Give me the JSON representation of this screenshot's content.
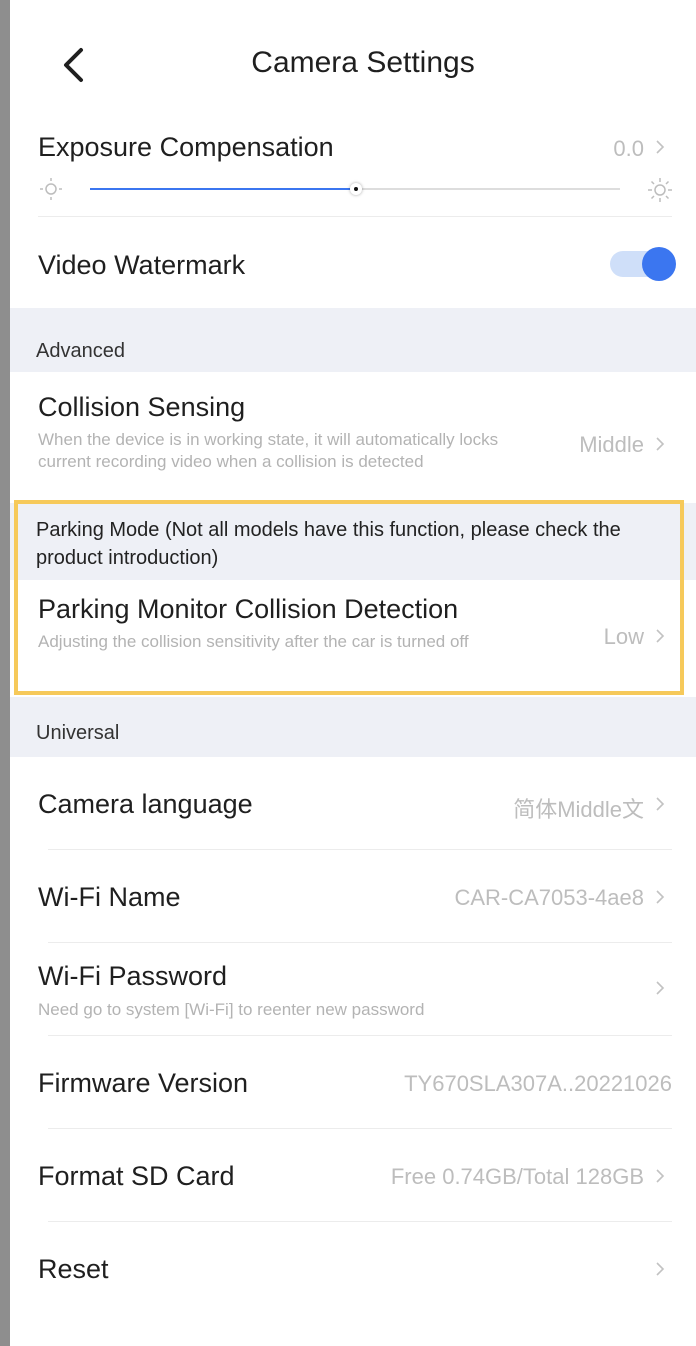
{
  "header": {
    "title": "Camera Settings"
  },
  "exposure": {
    "label": "Exposure Compensation",
    "value": "0.0",
    "level": 0.5
  },
  "watermark": {
    "label": "Video Watermark",
    "enabled": true
  },
  "sections": {
    "advanced": "Advanced",
    "parking": "Parking Mode (Not all models have this function, please check the product introduction)",
    "universal": "Universal"
  },
  "collision": {
    "label": "Collision Sensing",
    "desc": "When the device is in working state, it will automatically locks current recording video when a collision is detected",
    "value": "Middle"
  },
  "parking_detect": {
    "label": "Parking Monitor Collision Detection",
    "desc": "Adjusting the collision sensitivity after the car is turned off",
    "value": "Low"
  },
  "language": {
    "label": "Camera language",
    "value": "简体Middle文"
  },
  "wifi_name": {
    "label": "Wi-Fi Name",
    "value": "CAR-CA7053-4ae8"
  },
  "wifi_password": {
    "label": "Wi-Fi Password",
    "desc": "Need go to system [Wi-Fi] to reenter new password"
  },
  "firmware": {
    "label": "Firmware Version",
    "value": "TY670SLA307A..20221026"
  },
  "format": {
    "label": "Format SD Card",
    "value": "Free 0.74GB/Total 128GB"
  },
  "reset": {
    "label": "Reset"
  },
  "colors": {
    "accent": "#3b76f0",
    "highlight": "#f6c95a",
    "section_bg": "#eef0f6"
  },
  "icons": [
    "back-arrow-icon",
    "brightness-low-icon",
    "brightness-high-icon",
    "chevron-right-icon"
  ]
}
